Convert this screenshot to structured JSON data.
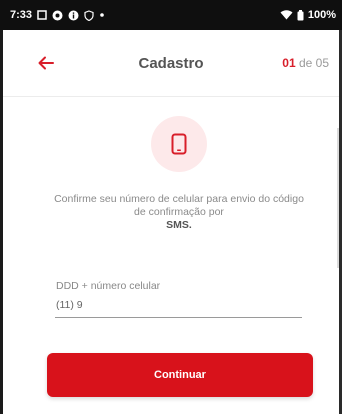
{
  "status_bar": {
    "time": "7:33",
    "battery": "100%",
    "icons": [
      "notification-square-icon",
      "record-icon",
      "info-icon",
      "shield-icon",
      "dot-icon",
      "wifi-icon",
      "battery-icon"
    ]
  },
  "header": {
    "back_icon": "arrow-left-icon",
    "title": "Cadastro",
    "step_current": "01",
    "step_suffix": " de 05"
  },
  "illustration": {
    "icon": "mobile-phone-icon"
  },
  "instruction": {
    "text": "Confirme seu número de celular para envio do código de confirmação por",
    "emphasis": "SMS."
  },
  "phone_field": {
    "label": "DDD + número celular",
    "value": "(11) 9"
  },
  "continue_button": {
    "label": "Continuar"
  },
  "colors": {
    "brand": "#d8121b",
    "status_bar": "#0f0f0f",
    "icon_circle": "#fde9ea",
    "text_muted": "#8a8a8a"
  }
}
